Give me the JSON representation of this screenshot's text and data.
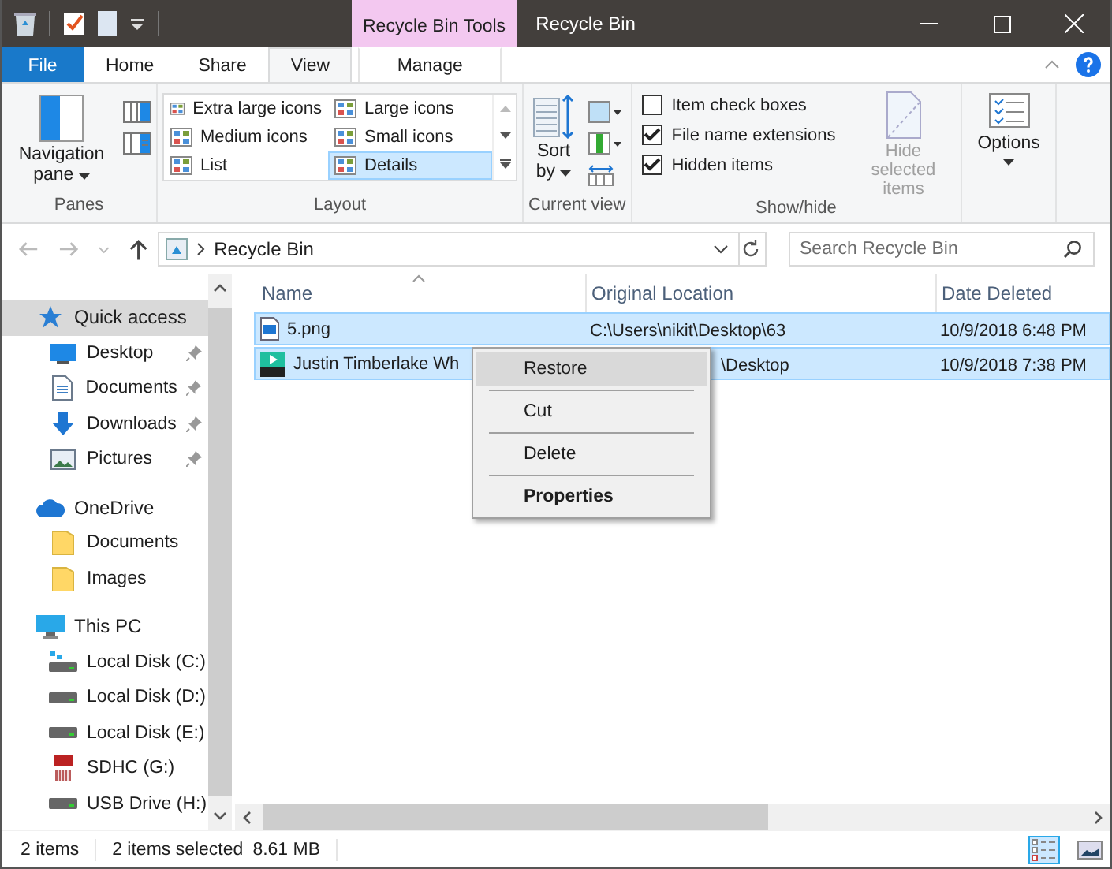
{
  "window": {
    "title": "Recycle Bin",
    "context_tab": "Recycle Bin Tools"
  },
  "ribbon_tabs": [
    {
      "label": "File",
      "kind": "file",
      "selected": false
    },
    {
      "label": "Home",
      "kind": "tab",
      "selected": false
    },
    {
      "label": "Share",
      "kind": "tab",
      "selected": false
    },
    {
      "label": "View",
      "kind": "tab",
      "selected": true
    },
    {
      "label": "Manage",
      "kind": "context",
      "selected": false
    }
  ],
  "panes": {
    "label": "Panes",
    "navigation_pane": "Navigation pane"
  },
  "layout": {
    "label": "Layout",
    "options": [
      {
        "label": "Extra large icons",
        "selected": false
      },
      {
        "label": "Large icons",
        "selected": false
      },
      {
        "label": "Medium icons",
        "selected": false
      },
      {
        "label": "Small icons",
        "selected": false
      },
      {
        "label": "List",
        "selected": false
      },
      {
        "label": "Details",
        "selected": true
      }
    ]
  },
  "current_view": {
    "label": "Current view",
    "sort": "Sort by"
  },
  "show_hide": {
    "label": "Show/hide",
    "checkboxes": [
      {
        "label": "Item check boxes",
        "checked": false
      },
      {
        "label": "File name extensions",
        "checked": true
      },
      {
        "label": "Hidden items",
        "checked": true
      }
    ],
    "hide_selected": {
      "label": "Hide selected items",
      "disabled": true
    }
  },
  "options": {
    "label": "Options"
  },
  "address": {
    "path": "Recycle Bin",
    "search_placeholder": "Search Recycle Bin"
  },
  "sidebar": [
    {
      "label": "Quick access",
      "kind": "star",
      "selected": true,
      "children": [
        {
          "label": "Desktop",
          "kind": "desktop",
          "pinned": true
        },
        {
          "label": "Documents",
          "kind": "docs",
          "pinned": true
        },
        {
          "label": "Downloads",
          "kind": "download",
          "pinned": true
        },
        {
          "label": "Pictures",
          "kind": "pictures",
          "pinned": true
        }
      ]
    },
    {
      "label": "OneDrive",
      "kind": "cloud",
      "selected": false,
      "children": [
        {
          "label": "Documents",
          "kind": "folder"
        },
        {
          "label": "Images",
          "kind": "folder"
        }
      ]
    },
    {
      "label": "This PC",
      "kind": "pc",
      "selected": false,
      "children": [
        {
          "label": "Local Disk (C:)",
          "kind": "windisk"
        },
        {
          "label": "Local Disk (D:)",
          "kind": "disk"
        },
        {
          "label": "Local Disk (E:)",
          "kind": "disk"
        },
        {
          "label": "SDHC (G:)",
          "kind": "sd"
        },
        {
          "label": "USB Drive (H:)",
          "kind": "disk"
        }
      ]
    }
  ],
  "columns": [
    "Name",
    "Original Location",
    "Date Deleted"
  ],
  "rows": [
    {
      "name": "5.png",
      "location": "C:\\Users\\nikit\\Desktop\\63",
      "date": "10/9/2018 6:48 PM",
      "kind": "image",
      "selected": true,
      "under_menu": false
    },
    {
      "name": "Justin Timberlake Wh",
      "location": "\\Desktop",
      "date": "10/9/2018 7:38 PM",
      "kind": "mp3",
      "selected": true,
      "under_menu": true
    }
  ],
  "context_menu": [
    {
      "label": "Restore",
      "selected": true,
      "bold": false
    },
    {
      "label": "Cut",
      "selected": false,
      "bold": false
    },
    {
      "label": "Delete",
      "selected": false,
      "bold": false
    },
    {
      "label": "Properties",
      "selected": false,
      "bold": true
    }
  ],
  "status_bar": {
    "count": "2 items",
    "selection": "2 items selected",
    "size": "8.61 MB"
  },
  "view_buttons": [
    {
      "kind": "details",
      "selected": true
    },
    {
      "kind": "large",
      "selected": false
    }
  ]
}
